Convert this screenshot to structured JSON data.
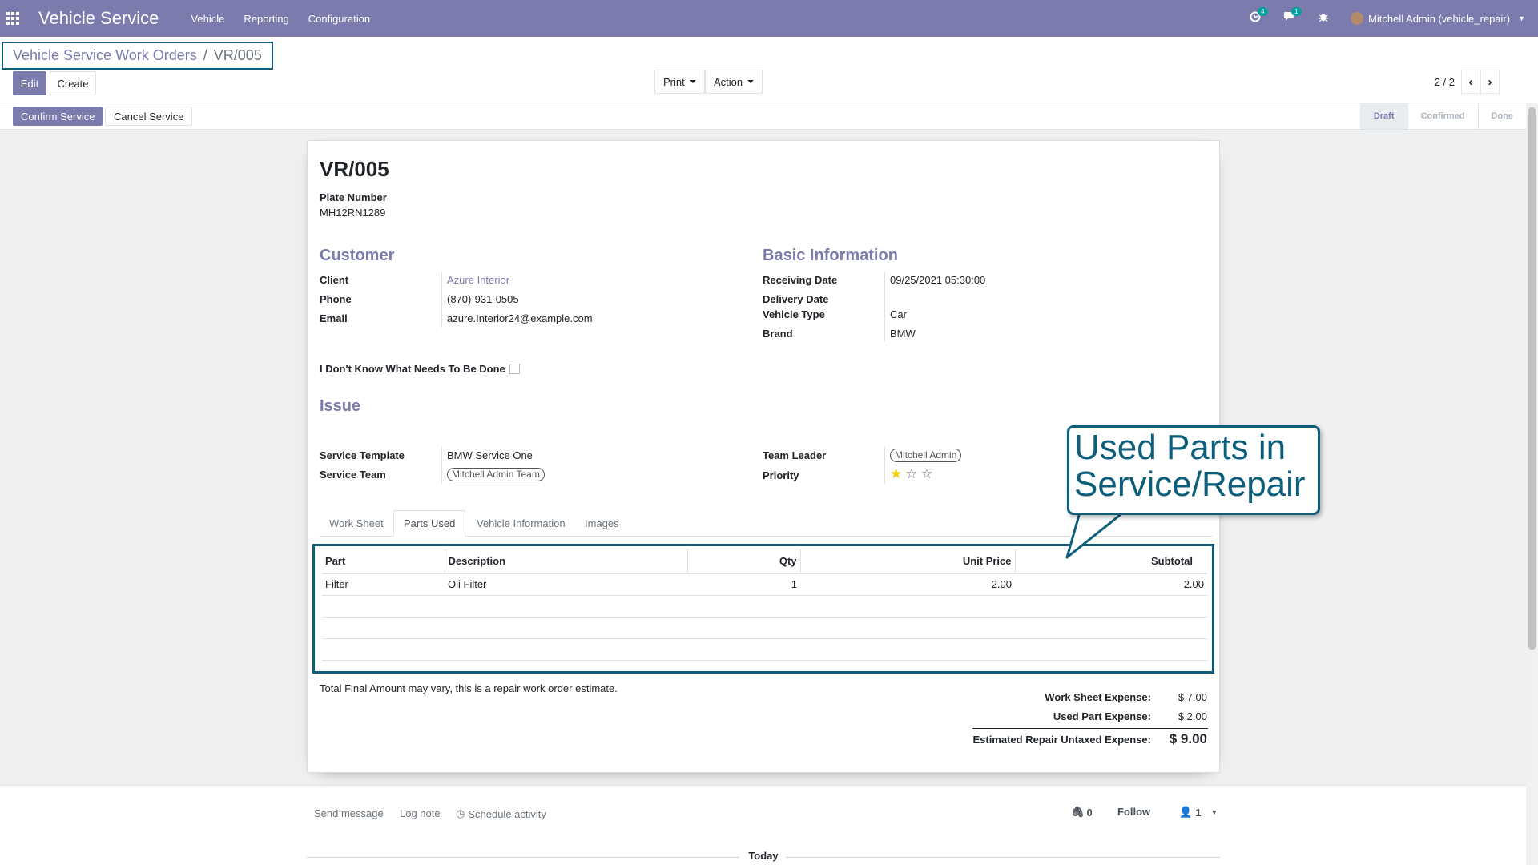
{
  "navbar": {
    "app_name": "Vehicle Service",
    "menu": [
      "Vehicle",
      "Reporting",
      "Configuration"
    ],
    "activity_count": "4",
    "message_count": "1",
    "user": "Mitchell Admin (vehicle_repair)"
  },
  "breadcrumb": {
    "parent": "Vehicle Service Work Orders",
    "separator": "/",
    "current": "VR/005"
  },
  "buttons": {
    "edit": "Edit",
    "create": "Create",
    "print": "Print",
    "action": "Action",
    "confirm": "Confirm Service",
    "cancel": "Cancel Service"
  },
  "pager": {
    "value": "2 / 2"
  },
  "stages": [
    "Draft",
    "Confirmed",
    "Done"
  ],
  "record": {
    "name": "VR/005",
    "plate_label": "Plate Number",
    "plate_value": "MH12RN1289",
    "customer_title": "Customer",
    "client_label": "Client",
    "client_value": "Azure Interior",
    "phone_label": "Phone",
    "phone_value": "(870)-931-0505",
    "email_label": "Email",
    "email_value": "azure.Interior24@example.com",
    "basic_title": "Basic Information",
    "receiving_label": "Receiving Date",
    "receiving_value": "09/25/2021 05:30:00",
    "delivery_label": "Delivery Date",
    "vehicle_type_label": "Vehicle Type",
    "vehicle_type_value": "Car",
    "brand_label": "Brand",
    "brand_value": "BMW",
    "unknown_label": "I Don't Know What Needs To Be Done",
    "issue_title": "Issue",
    "template_label": "Service Template",
    "template_value": "BMW Service One",
    "team_label": "Service Team",
    "team_value": "Mitchell Admin Team",
    "leader_label": "Team Leader",
    "leader_value": "Mitchell Admin",
    "priority_label": "Priority",
    "priority_stars": 1
  },
  "tabs": [
    "Work Sheet",
    "Parts Used",
    "Vehicle Information",
    "Images"
  ],
  "parts": {
    "columns": [
      "Part",
      "Description",
      "Qty",
      "Unit Price",
      "Subtotal"
    ],
    "rows": [
      [
        "Filter",
        "Oli Filter",
        "1",
        "2.00",
        "2.00"
      ]
    ]
  },
  "note": "Total Final Amount may vary, this is a repair work order estimate.",
  "totals": {
    "worksheet_label": "Work Sheet Expense:",
    "worksheet_value": "$ 7.00",
    "parts_label": "Used Part Expense:",
    "parts_value": "$ 2.00",
    "estimate_label": "Estimated Repair Untaxed Expense:",
    "estimate_value": "$ 9.00"
  },
  "callout": {
    "line1": "Used Parts in",
    "line2": "Service/Repair"
  },
  "chatter": {
    "send_message": "Send message",
    "log_note": "Log note",
    "schedule": "Schedule activity",
    "attachments": "0",
    "follow": "Follow",
    "followers": "1",
    "today": "Today"
  },
  "colors": {
    "primary": "#7c7bad",
    "callout": "#0d5e7a",
    "star": "#f3cc00"
  }
}
